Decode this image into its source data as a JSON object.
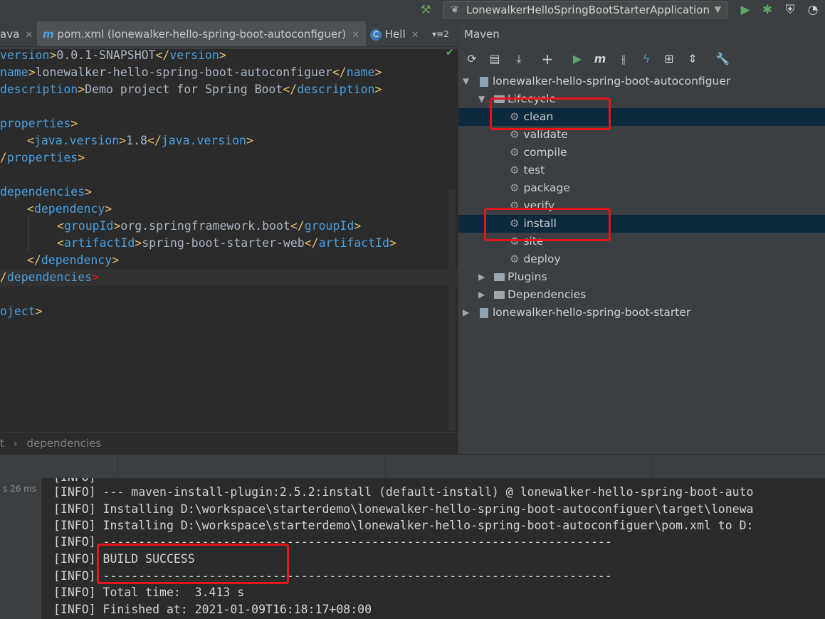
{
  "toolbar": {
    "run_config": "LonewalkerHelloSpringBootStarterApplication",
    "icons": [
      "hammer-icon",
      "run-icon",
      "debug-icon",
      "coverage-icon",
      "profile-icon"
    ]
  },
  "tabs": [
    {
      "label": "ava"
    },
    {
      "label": "pom.xml (lonewalker-hello-spring-boot-autoconfiguer)",
      "icon": "m"
    },
    {
      "label": "Hell",
      "icon": "C"
    }
  ],
  "tabs_overflow": "2",
  "editor": {
    "lines": [
      {
        "open": "version",
        "text": "0.0.1-SNAPSHOT",
        "close": "version"
      },
      {
        "open": "name",
        "text": "lonewalker-hello-spring-boot-autoconfiguer",
        "close": "name"
      },
      {
        "open": "description",
        "text": "Demo project for Spring Boot",
        "close": "description"
      },
      {
        "open": "properties"
      },
      {
        "open": "java.version",
        "text": "1.8",
        "close": "java.version"
      },
      {
        "close": "properties"
      },
      {
        "open": "dependencies"
      },
      {
        "open": "dependency"
      },
      {
        "open": "groupId",
        "text": "org.springframework.boot",
        "close": "groupId"
      },
      {
        "open": "artifactId",
        "text": "spring-boot-starter-web",
        "close": "artifactId"
      },
      {
        "close": "dependency"
      },
      {
        "close": "dependencies"
      },
      {
        "close": "oject"
      }
    ]
  },
  "breadcrumb": {
    "first": "t",
    "sep": "›",
    "second": "dependencies"
  },
  "maven": {
    "title": "Maven",
    "project1": "lonewalker-hello-spring-boot-autoconfiguer",
    "lifecycle": "Lifecycle",
    "phases": [
      "clean",
      "validate",
      "compile",
      "test",
      "package",
      "verify",
      "install",
      "site",
      "deploy"
    ],
    "plugins": "Plugins",
    "dependencies": "Dependencies",
    "project2": "lonewalker-hello-spring-boot-starter"
  },
  "console": {
    "time_label": "s 26 ms",
    "lines": [
      "[INFO]",
      "[INFO] --- maven-install-plugin:2.5.2:install (default-install) @ lonewalker-hello-spring-boot-auto",
      "[INFO] Installing D:\\workspace\\starterdemo\\lonewalker-hello-spring-boot-autoconfiguer\\target\\lonewa",
      "[INFO] Installing D:\\workspace\\starterdemo\\lonewalker-hello-spring-boot-autoconfiguer\\pom.xml to D:",
      "[INFO] ------------------------------------------------------------------------",
      "[INFO] BUILD SUCCESS",
      "[INFO] ------------------------------------------------------------------------",
      "[INFO] Total time:  3.413 s",
      "[INFO] Finished at: 2021-01-09T16:18:17+08:00"
    ]
  },
  "colors": {
    "highlight_box": "#e8141d",
    "selection": "#0d293e",
    "tag": "#e8bf6a",
    "tag_name": "#4aa0e0"
  }
}
